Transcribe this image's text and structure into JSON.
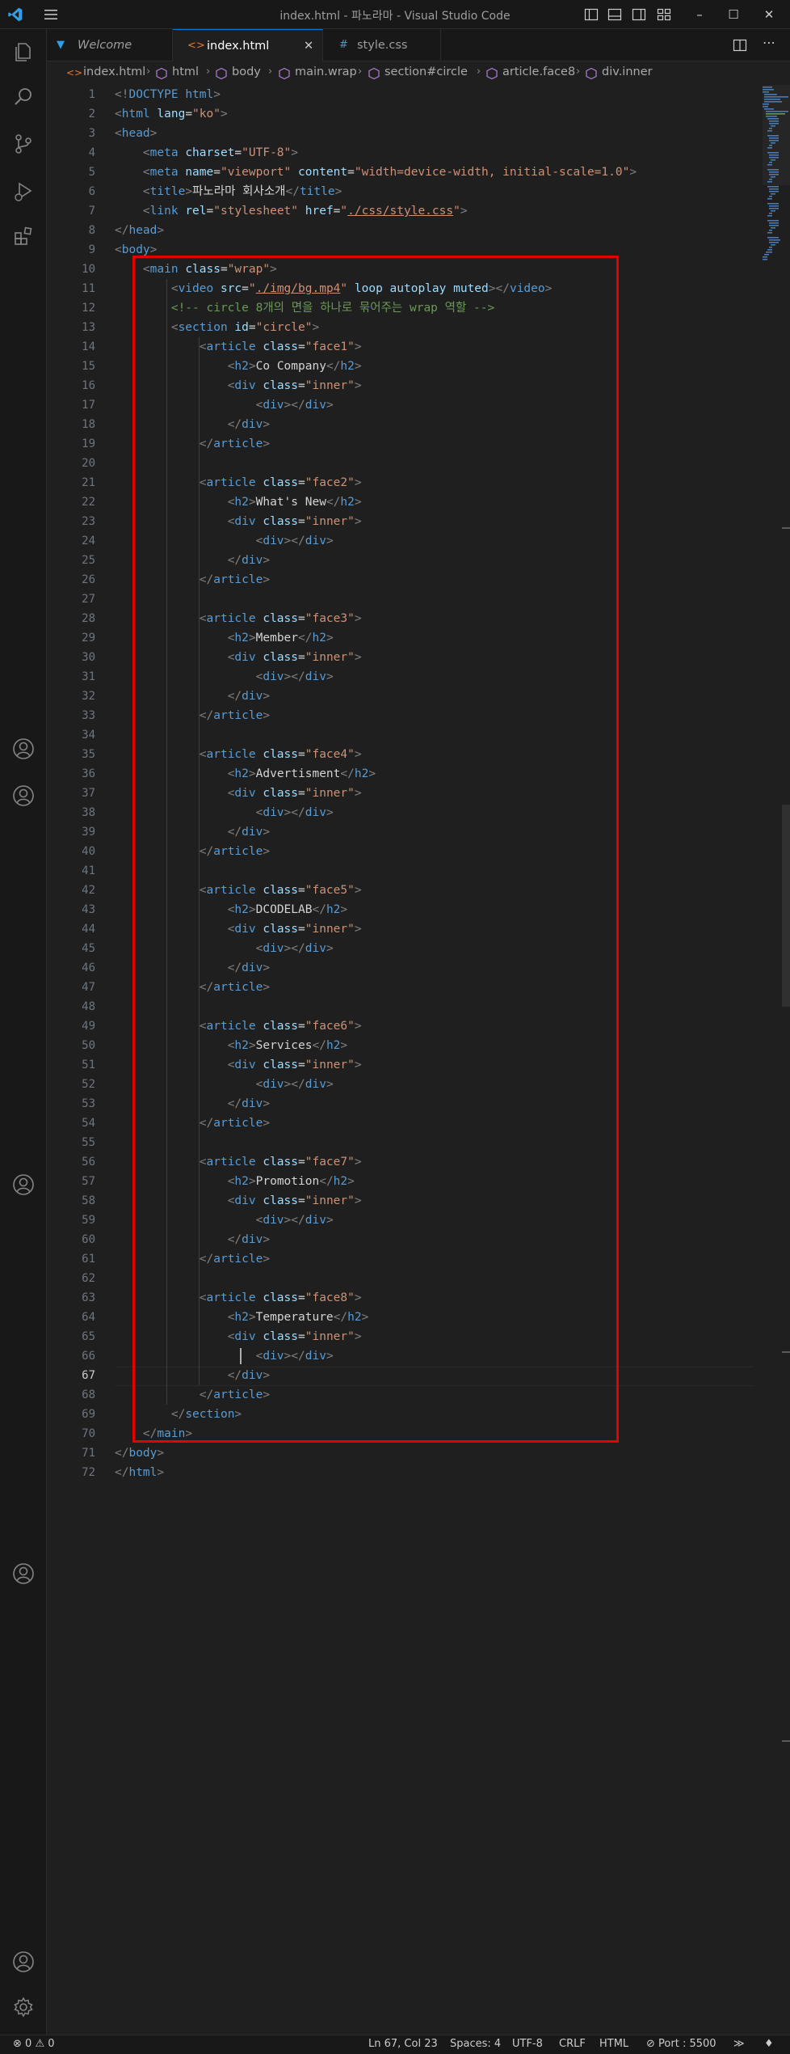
{
  "window": {
    "title": "index.html - 파노라마 - Visual Studio Code"
  },
  "tabs": [
    {
      "label": "Welcome",
      "icon": "vscode-icon"
    },
    {
      "label": "index.html",
      "icon": "html-icon",
      "active": true
    },
    {
      "label": "style.css",
      "icon": "css-icon"
    }
  ],
  "breadcrumb": [
    "index.html",
    "html",
    "body",
    "main.wrap",
    "section#circle",
    "article.face8",
    "div.inner"
  ],
  "editor": {
    "current_line": 67,
    "lines": [
      "<!DOCTYPE html>",
      "<html lang=\"ko\">",
      "<head>",
      "    <meta charset=\"UTF-8\">",
      "    <meta name=\"viewport\" content=\"width=device-width, initial-scale=1.0\">",
      "    <title>파노라마 회사소개</title>",
      "    <link rel=\"stylesheet\" href=\"./css/style.css\">",
      "</head>",
      "<body>",
      "    <main class=\"wrap\">",
      "        <video src=\"./img/bg.mp4\" loop autoplay muted></video>",
      "        <!-- circle 8개의 면을 하나로 묶어주는 wrap 역할 -->",
      "        <section id=\"circle\">",
      "            <article class=\"face1\">",
      "                <h2>Co Company</h2>",
      "                <div class=\"inner\">",
      "                    <div></div>",
      "                </div>",
      "            </article>",
      "",
      "            <article class=\"face2\">",
      "                <h2>What's New</h2>",
      "                <div class=\"inner\">",
      "                    <div></div>",
      "                </div>",
      "            </article>",
      "",
      "            <article class=\"face3\">",
      "                <h2>Member</h2>",
      "                <div class=\"inner\">",
      "                    <div></div>",
      "                </div>",
      "            </article>",
      "",
      "            <article class=\"face4\">",
      "                <h2>Advertisment</h2>",
      "                <div class=\"inner\">",
      "                    <div></div>",
      "                </div>",
      "            </article>",
      "",
      "            <article class=\"face5\">",
      "                <h2>DCODELAB</h2>",
      "                <div class=\"inner\">",
      "                    <div></div>",
      "                </div>",
      "            </article>",
      "",
      "            <article class=\"face6\">",
      "                <h2>Services</h2>",
      "                <div class=\"inner\">",
      "                    <div></div>",
      "                </div>",
      "            </article>",
      "",
      "            <article class=\"face7\">",
      "                <h2>Promotion</h2>",
      "                <div class=\"inner\">",
      "                    <div></div>",
      "                </div>",
      "            </article>",
      "",
      "            <article class=\"face8\">",
      "                <h2>Temperature</h2>",
      "                <div class=\"inner\">",
      "                    <div></div>",
      "                </div>",
      "            </article>",
      "        </section>",
      "    </main>",
      "</body>",
      "</html>"
    ]
  },
  "statusbar": {
    "errors": "0",
    "warnings": "0",
    "position": "Ln 67, Col 23",
    "spaces": "Spaces: 4",
    "encoding": "UTF-8",
    "eol": "CRLF",
    "language": "HTML",
    "port": "Port : 5500"
  },
  "colors": {
    "accent": "#0078d4",
    "highlight_box": "#e60000",
    "tag": "#569cd6",
    "attr": "#9cdcfe",
    "string": "#ce9178",
    "comment": "#6a9955"
  }
}
